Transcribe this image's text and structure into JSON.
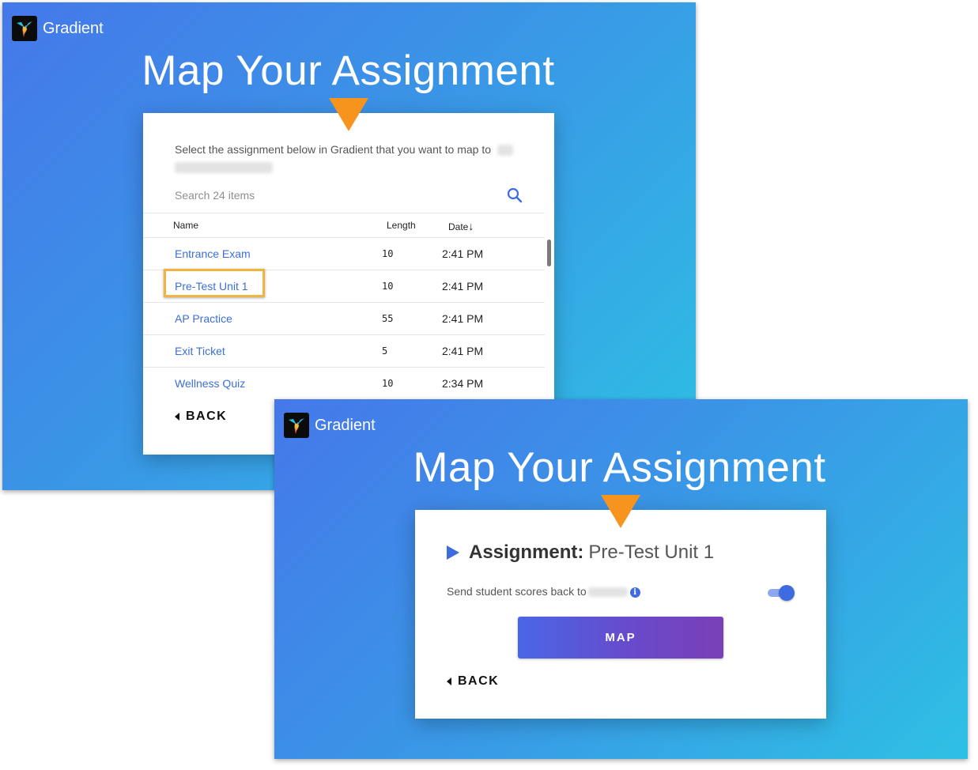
{
  "brand": {
    "name": "Gradient"
  },
  "screen1": {
    "title": "Map Your Assignment",
    "instruction": "Select the assignment below in Gradient that you want to map to",
    "search": {
      "placeholder": "Search 24 items",
      "value": ""
    },
    "table": {
      "columns": {
        "name": "Name",
        "length": "Length",
        "date": "Date",
        "date_sort": "↓"
      },
      "rows": [
        {
          "name": "Entrance Exam",
          "length": "10",
          "date": "2:41 PM"
        },
        {
          "name": "Pre-Test Unit 1",
          "length": "10",
          "date": "2:41 PM",
          "highlighted": true
        },
        {
          "name": "AP Practice",
          "length": "55",
          "date": "2:41 PM"
        },
        {
          "name": "Exit Ticket",
          "length": "5",
          "date": "2:41 PM"
        },
        {
          "name": "Wellness Quiz",
          "length": "10",
          "date": "2:34 PM"
        }
      ]
    },
    "back_label": "BACK"
  },
  "screen2": {
    "title": "Map Your Assignment",
    "assignment_label": "Assignment:",
    "assignment_value": "Pre-Test Unit 1",
    "send_scores_label": "Send student scores back to",
    "info_icon": "i",
    "send_scores_enabled": true,
    "map_label": "MAP",
    "back_label": "BACK"
  },
  "colors": {
    "accent": "#3e6be0",
    "pointer": "#f7941d",
    "highlight": "#f2b441",
    "link": "#3c6fd6"
  }
}
